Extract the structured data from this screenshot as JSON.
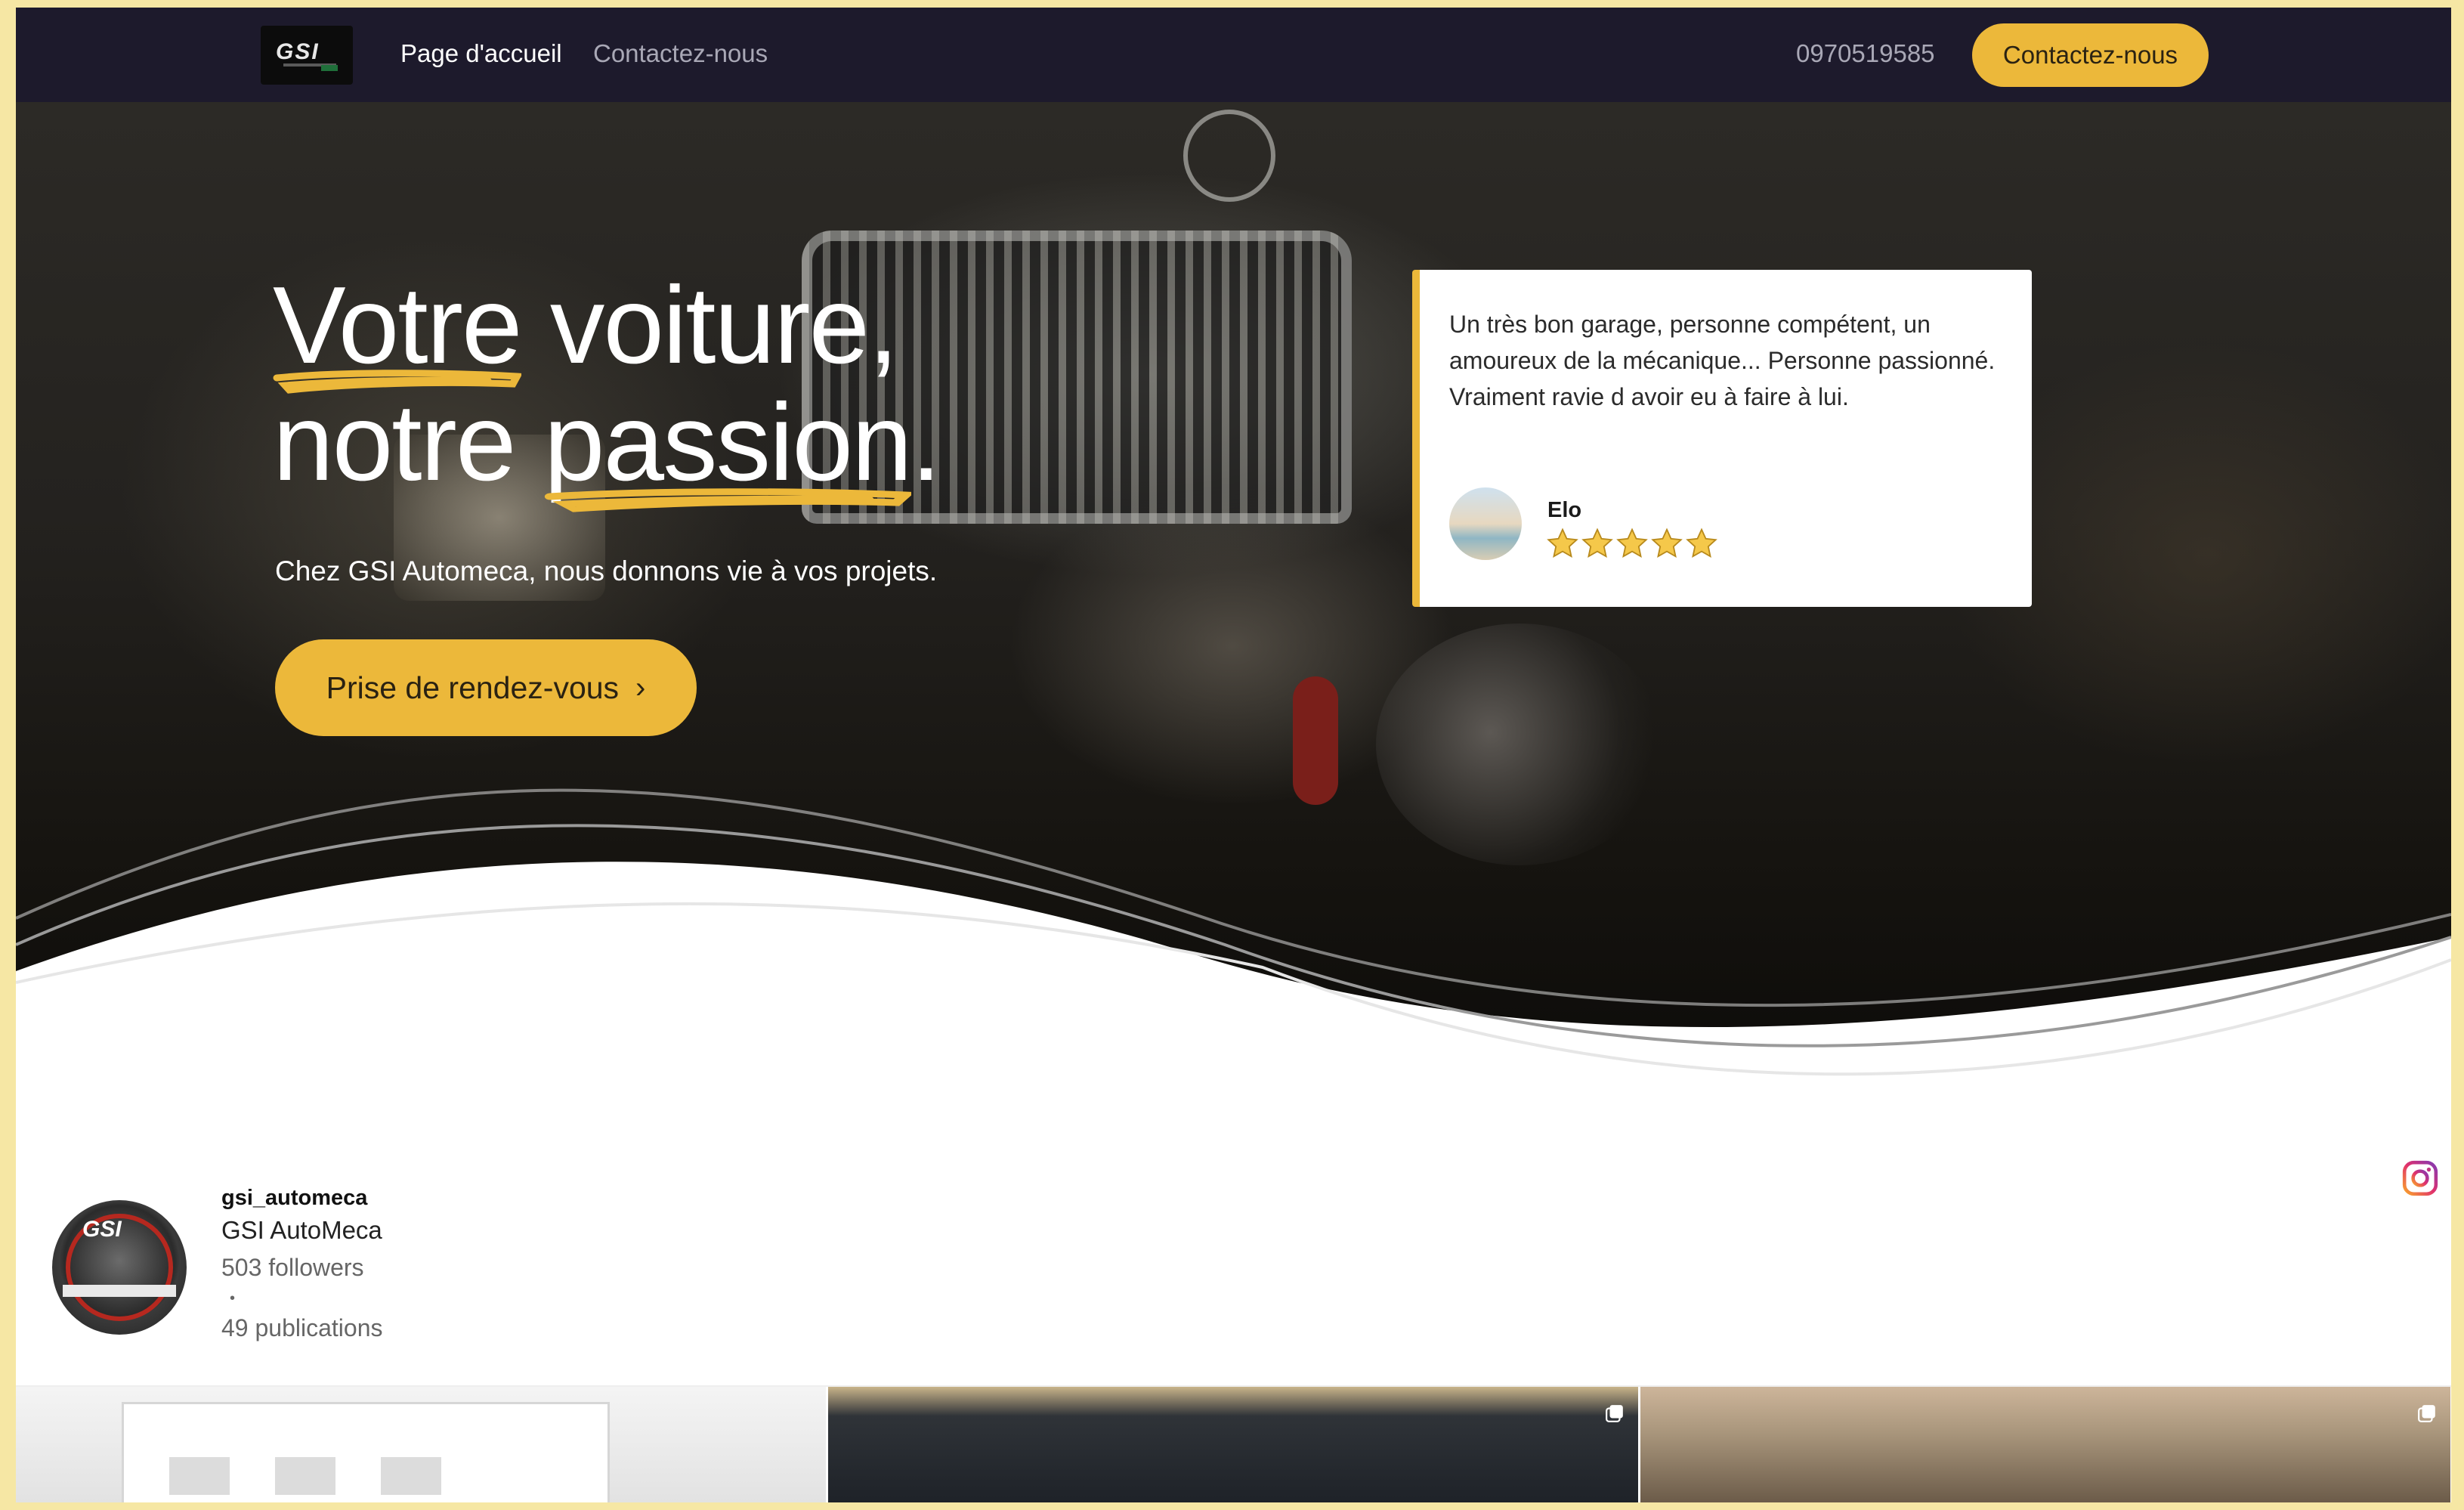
{
  "nav": {
    "logo_text": "GSI",
    "links": [
      "Page d'accueil",
      "Contactez-nous"
    ],
    "phone": "0970519585",
    "cta": "Contactez-nous"
  },
  "hero": {
    "headline_line1_a": "Votre",
    "headline_line1_b": " voiture,",
    "headline_line2_a": "notre ",
    "headline_line2_b": "passion",
    "headline_line2_c": ".",
    "subtitle": "Chez GSI Automeca, nous donnons vie à vos projets.",
    "cta": "Prise de rendez-vous",
    "cta_icon": "chevron-right-icon",
    "accent_color": "#ecb83a"
  },
  "review": {
    "text": "Un très bon garage, personne compétent, un amoureux de la mécanique... Personne passionné. Vraiment ravie d avoir eu à faire à lui.",
    "author": "Elo",
    "rating": 5
  },
  "instagram": {
    "username": "gsi_automeca",
    "name": "GSI AutoMeca",
    "followers": "503 followers",
    "dot": "•",
    "posts": "49 publications",
    "profile_badge": "GSI",
    "icon": "instagram-icon"
  },
  "colors": {
    "nav_bg": "#1d1a2c",
    "accent": "#ecb83a",
    "page_border": "#f6e7a4"
  }
}
